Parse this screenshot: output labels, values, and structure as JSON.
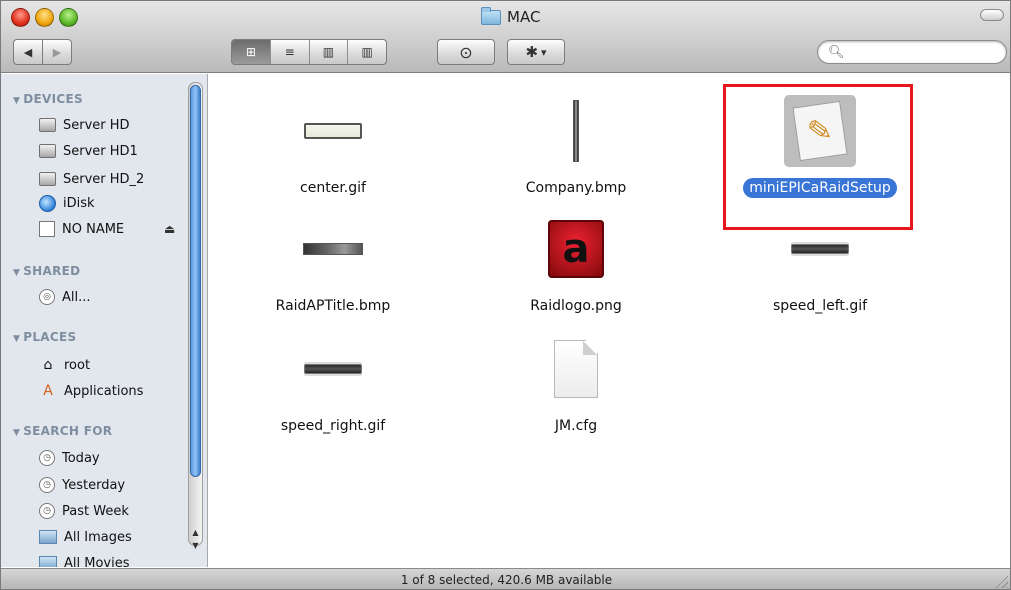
{
  "window": {
    "title": "MAC"
  },
  "toolbar": {
    "back_icon": "◀",
    "forward_icon": "▶",
    "view_modes": [
      "icon-view",
      "list-view",
      "column-view",
      "coverflow-view"
    ],
    "view_glyphs": [
      "⊞",
      "≡",
      "▥",
      "▥"
    ],
    "active_view": "icon-view",
    "quicklook_icon": "⊙",
    "action_icon": "✱",
    "action_dropdown": "▾",
    "search_placeholder": ""
  },
  "sidebar": {
    "sections": [
      {
        "title": "DEVICES",
        "items": [
          {
            "label": "Server HD",
            "icon": "hard-drive-icon"
          },
          {
            "label": "Server HD1",
            "icon": "hard-drive-icon"
          },
          {
            "label": "Server HD_2",
            "icon": "hard-drive-icon"
          },
          {
            "label": "iDisk",
            "icon": "idisk-icon"
          },
          {
            "label": "NO NAME",
            "icon": "removable-disk-icon"
          }
        ]
      },
      {
        "title": "SHARED",
        "items": [
          {
            "label": "All...",
            "icon": "network-icon"
          }
        ]
      },
      {
        "title": "PLACES",
        "items": [
          {
            "label": "root",
            "icon": "home-icon"
          },
          {
            "label": "Applications",
            "icon": "applications-icon"
          }
        ]
      },
      {
        "title": "SEARCH FOR",
        "items": [
          {
            "label": "Today",
            "icon": "clock-icon"
          },
          {
            "label": "Yesterday",
            "icon": "clock-icon"
          },
          {
            "label": "Past Week",
            "icon": "clock-icon"
          },
          {
            "label": "All Images",
            "icon": "images-folder-icon"
          },
          {
            "label": "All Movies",
            "icon": "movies-folder-icon"
          }
        ]
      }
    ]
  },
  "files": [
    {
      "name": "center.gif",
      "icon": "bar-thumbnail-icon",
      "selected": false
    },
    {
      "name": "Company.bmp",
      "icon": "vertical-bar-thumbnail-icon",
      "selected": false
    },
    {
      "name": "miniEPICaRaidSetup",
      "icon": "application-icon",
      "selected": true
    },
    {
      "name": "RaidAPTitle.bmp",
      "icon": "title-strip-thumbnail-icon",
      "selected": false
    },
    {
      "name": "Raidlogo.png",
      "icon": "raid-logo-icon",
      "selected": false
    },
    {
      "name": "speed_left.gif",
      "icon": "speed-bar-thumbnail-icon",
      "selected": false
    },
    {
      "name": "speed_right.gif",
      "icon": "speed-bar-thumbnail-icon",
      "selected": false
    },
    {
      "name": "JM.cfg",
      "icon": "document-icon",
      "selected": false
    }
  ],
  "status": {
    "text": "1 of 8 selected, 420.6 MB available"
  },
  "colors": {
    "selection": "#3875d7",
    "highlight_box": "#e8161c",
    "sidebar_bg": "#e2e7ed"
  }
}
